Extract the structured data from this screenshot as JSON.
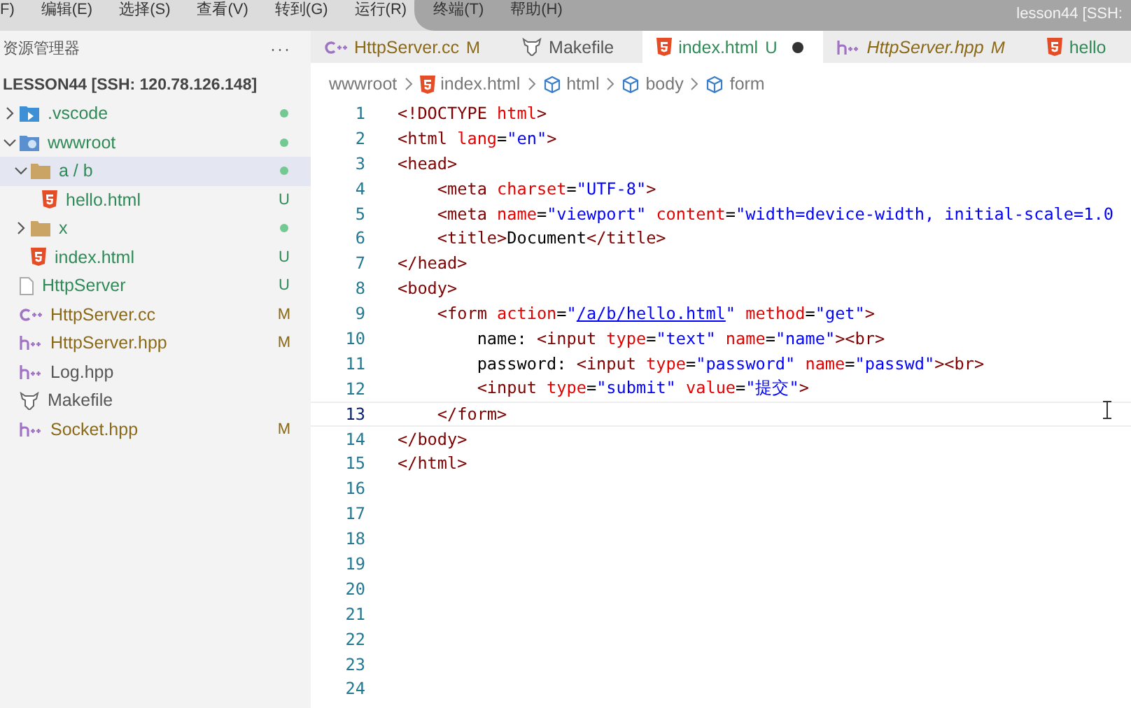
{
  "menu_bar": {
    "items": [
      "F)",
      "编辑(E)",
      "选择(S)",
      "查看(V)",
      "转到(G)",
      "运行(R)",
      "终端(T)",
      "帮助(H)"
    ],
    "command_center": "lesson44 [SSH:"
  },
  "sidebar": {
    "title": "资源管理器",
    "more": "···",
    "root": "LESSON44 [SSH: 120.78.126.148]",
    "items": [
      {
        "label": ".vscode",
        "kind": "vscode-folder",
        "expanded": false,
        "selected": false,
        "color": "#2e8b57",
        "changes": true
      },
      {
        "label": "wwwroot",
        "kind": "web-folder",
        "expanded": true,
        "selected": false,
        "color": "#2e8b57",
        "changes": true,
        "children": [
          {
            "label": "a / b",
            "kind": "folder",
            "expanded": true,
            "selected": true,
            "color": "#2e8b57",
            "changes": true,
            "children": [
              {
                "label": "hello.html",
                "kind": "html",
                "selected": false,
                "color": "#2e8b57",
                "badge": "U"
              }
            ]
          },
          {
            "label": "x",
            "kind": "folder",
            "expanded": false,
            "selected": false,
            "color": "#2e8b57",
            "changes": true
          },
          {
            "label": "index.html",
            "kind": "html",
            "selected": false,
            "color": "#2e8b57",
            "badge": "U"
          }
        ]
      },
      {
        "label": "HttpServer",
        "kind": "file",
        "selected": false,
        "color": "#2e8b57",
        "badge": "U"
      },
      {
        "label": "HttpServer.cc",
        "kind": "cpp",
        "selected": false,
        "color": "#8b6914",
        "badge": "M"
      },
      {
        "label": "HttpServer.hpp",
        "kind": "hpp",
        "selected": false,
        "color": "#8b6914",
        "badge": "M"
      },
      {
        "label": "Log.hpp",
        "kind": "hpp",
        "selected": false,
        "color": "#555555"
      },
      {
        "label": "Makefile",
        "kind": "make",
        "selected": false,
        "color": "#555555"
      },
      {
        "label": "Socket.hpp",
        "kind": "hpp",
        "selected": false,
        "color": "#8b6914",
        "badge": "M"
      }
    ]
  },
  "tabs": [
    {
      "label": "HttpServer.cc",
      "kind": "cpp",
      "badge": "M",
      "color": "#8b6914",
      "selected": false,
      "italic": false,
      "dirty": false
    },
    {
      "label": "Makefile",
      "kind": "make",
      "color": "#555555",
      "selected": false,
      "italic": false,
      "dirty": false
    },
    {
      "label": "index.html",
      "kind": "html",
      "badge": "U",
      "color": "#2e8b57",
      "selected": true,
      "italic": false,
      "dirty": true
    },
    {
      "label": "HttpServer.hpp",
      "kind": "hpp",
      "badge": "M",
      "color": "#8b6914",
      "selected": false,
      "italic": true,
      "dirty": false
    },
    {
      "label": "hello",
      "kind": "html",
      "color": "#2e8b57",
      "selected": false,
      "italic": false,
      "dirty": false
    }
  ],
  "breadcrumbs": [
    {
      "label": "wwwroot",
      "kind": "folder-path"
    },
    {
      "label": "index.html",
      "kind": "html"
    },
    {
      "label": "html",
      "kind": "element"
    },
    {
      "label": "body",
      "kind": "element"
    },
    {
      "label": "form",
      "kind": "element"
    }
  ],
  "code": {
    "lines": [
      {
        "number": "1",
        "tokens": [
          {
            "kind": "tag",
            "text": "<!DOCTYPE "
          },
          {
            "kind": "attr",
            "text": "html"
          },
          {
            "kind": "tag",
            "text": ">"
          }
        ]
      },
      {
        "number": "2",
        "tokens": [
          {
            "kind": "tag",
            "text": "<html "
          },
          {
            "kind": "attr",
            "text": "lang"
          },
          {
            "kind": "text",
            "text": "="
          },
          {
            "kind": "str",
            "text": "\"en\""
          },
          {
            "kind": "tag",
            "text": ">"
          }
        ]
      },
      {
        "number": "3",
        "tokens": [
          {
            "kind": "tag",
            "text": "<head>"
          }
        ]
      },
      {
        "number": "4",
        "tokens": [
          {
            "kind": "tag",
            "text": "    <meta "
          },
          {
            "kind": "attr",
            "text": "charset"
          },
          {
            "kind": "text",
            "text": "="
          },
          {
            "kind": "str",
            "text": "\"UTF-8\""
          },
          {
            "kind": "tag",
            "text": ">"
          }
        ]
      },
      {
        "number": "5",
        "tokens": [
          {
            "kind": "tag",
            "text": "    <meta "
          },
          {
            "kind": "attr",
            "text": "name"
          },
          {
            "kind": "text",
            "text": "="
          },
          {
            "kind": "str",
            "text": "\"viewport\""
          },
          {
            "kind": "attr",
            "text": " content"
          },
          {
            "kind": "text",
            "text": "="
          },
          {
            "kind": "str",
            "text": "\"width=device-width, initial-scale=1.0"
          }
        ]
      },
      {
        "number": "6",
        "tokens": [
          {
            "kind": "tag",
            "text": "    <title>"
          },
          {
            "kind": "text",
            "text": "Document"
          },
          {
            "kind": "tag",
            "text": "</title>"
          }
        ]
      },
      {
        "number": "7",
        "tokens": [
          {
            "kind": "tag",
            "text": "</head>"
          }
        ]
      },
      {
        "number": "8",
        "tokens": [
          {
            "kind": "tag",
            "text": "<body>"
          }
        ]
      },
      {
        "number": "9",
        "tokens": [
          {
            "kind": "tag",
            "text": "    <form "
          },
          {
            "kind": "attr",
            "text": "action"
          },
          {
            "kind": "text",
            "text": "="
          },
          {
            "kind": "str",
            "text": "\""
          },
          {
            "kind": "link",
            "text": "/a/b/hello.html"
          },
          {
            "kind": "str",
            "text": "\""
          },
          {
            "kind": "attr",
            "text": " method"
          },
          {
            "kind": "text",
            "text": "="
          },
          {
            "kind": "str",
            "text": "\"get\""
          },
          {
            "kind": "tag",
            "text": ">"
          }
        ]
      },
      {
        "number": "10",
        "tokens": [
          {
            "kind": "text",
            "text": "        name: "
          },
          {
            "kind": "tag",
            "text": "<input "
          },
          {
            "kind": "attr",
            "text": "type"
          },
          {
            "kind": "text",
            "text": "="
          },
          {
            "kind": "str",
            "text": "\"text\""
          },
          {
            "kind": "attr",
            "text": " name"
          },
          {
            "kind": "text",
            "text": "="
          },
          {
            "kind": "str",
            "text": "\"name\""
          },
          {
            "kind": "tag",
            "text": "><br>"
          }
        ]
      },
      {
        "number": "11",
        "tokens": [
          {
            "kind": "text",
            "text": "        password: "
          },
          {
            "kind": "tag",
            "text": "<input "
          },
          {
            "kind": "attr",
            "text": "type"
          },
          {
            "kind": "text",
            "text": "="
          },
          {
            "kind": "str",
            "text": "\"password\""
          },
          {
            "kind": "attr",
            "text": " name"
          },
          {
            "kind": "text",
            "text": "="
          },
          {
            "kind": "str",
            "text": "\"passwd\""
          },
          {
            "kind": "tag",
            "text": "><br>"
          }
        ]
      },
      {
        "number": "12",
        "tokens": [
          {
            "kind": "tag",
            "text": "        <input "
          },
          {
            "kind": "attr",
            "text": "type"
          },
          {
            "kind": "text",
            "text": "="
          },
          {
            "kind": "str",
            "text": "\"submit\""
          },
          {
            "kind": "attr",
            "text": " value"
          },
          {
            "kind": "text",
            "text": "="
          },
          {
            "kind": "str",
            "text": "\"提交\""
          },
          {
            "kind": "tag",
            "text": ">"
          }
        ]
      },
      {
        "number": "13",
        "current": true,
        "tokens": [
          {
            "kind": "tag",
            "text": "    </form>"
          }
        ]
      },
      {
        "number": "14",
        "tokens": [
          {
            "kind": "tag",
            "text": "</body>"
          }
        ]
      },
      {
        "number": "15",
        "tokens": [
          {
            "kind": "tag",
            "text": "</html>"
          }
        ]
      },
      {
        "number": "16"
      },
      {
        "number": "17"
      },
      {
        "number": "18"
      },
      {
        "number": "19"
      },
      {
        "number": "20"
      },
      {
        "number": "21"
      },
      {
        "number": "22"
      },
      {
        "number": "23"
      },
      {
        "number": "24"
      }
    ]
  }
}
